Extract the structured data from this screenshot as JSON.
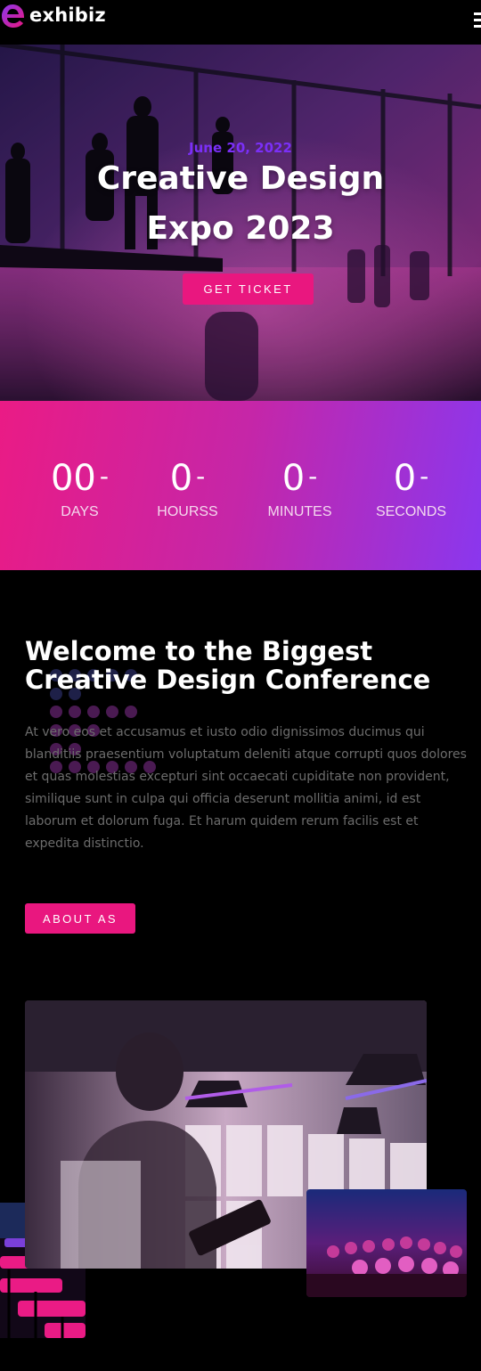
{
  "header": {
    "brand": "exhibiz",
    "logo_icon": "e-logo-icon",
    "menu_icon": "hamburger-menu-icon"
  },
  "hero": {
    "date": "June 20, 2022",
    "title_line1": "Creative Design",
    "title_line2": "Expo 2023",
    "cta_label": "GET TICKET"
  },
  "countdown": {
    "items": [
      {
        "value": "00",
        "label": "DAYS"
      },
      {
        "value": "0",
        "label": "HOURSS"
      },
      {
        "value": "0",
        "label": "MINUTES"
      },
      {
        "value": "0",
        "label": "SECONDS"
      }
    ],
    "separator": "-"
  },
  "about": {
    "title_line1": "Welcome to the Biggest",
    "title_line2": "Creative Design Conference",
    "paragraph": "At vero eos et accusamus et iusto odio dignissimos ducimus qui blanditiis praesentium voluptatum deleniti atque corrupti quos dolores et quas molestias excepturi sint occaecati cupiditate non provident, similique sunt in culpa qui officia deserunt mollitia animi, id est laborum et dolorum fuga. Et harum quidem rerum facilis est et expedita distinctio.",
    "cta_label": "ABOUT AS"
  },
  "colors": {
    "accent_pink": "#e9177f",
    "accent_purple": "#8a37ee",
    "date_purple": "#7b2ff7",
    "background": "#000000"
  }
}
